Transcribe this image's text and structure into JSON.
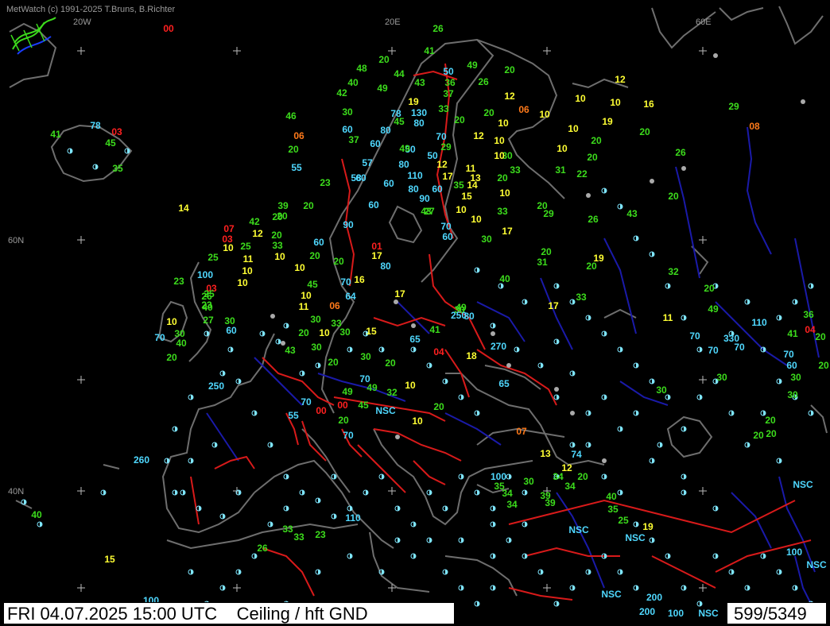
{
  "header": {
    "credit": "MetWatch  (c) 1991-2025 T.Bruns, B.Richter"
  },
  "footer": {
    "timestamp": "FRI 04.07.2025 15:00 UTC",
    "product": "Ceiling / hft GND",
    "count": "599/5349"
  },
  "colors": {
    "background": "#000000",
    "coast": "#6e6e6e",
    "river": "#1a1aa8",
    "border": "#d81a1a",
    "station": "#7fe6ff",
    "cyan_value": "#4fd8ff",
    "green_value": "#3cdc1c",
    "yellow_value": "#ffff33",
    "orange_value": "#ff7a1a",
    "red_value": "#ff2020"
  },
  "grid_labels": [
    "20W",
    "20E",
    "60E",
    "60N",
    "40N"
  ],
  "ceiling_values": [
    {
      "t": "00",
      "c": "red"
    },
    {
      "t": "26",
      "c": "green"
    },
    {
      "t": "41",
      "c": "green"
    },
    {
      "t": "50",
      "c": "cyan"
    },
    {
      "t": "49",
      "c": "green"
    },
    {
      "t": "20",
      "c": "green"
    },
    {
      "t": "48",
      "c": "green"
    },
    {
      "t": "20",
      "c": "green"
    },
    {
      "t": "44",
      "c": "green"
    },
    {
      "t": "43",
      "c": "green"
    },
    {
      "t": "36",
      "c": "green"
    },
    {
      "t": "26",
      "c": "green"
    },
    {
      "t": "40",
      "c": "green"
    },
    {
      "t": "49",
      "c": "green"
    },
    {
      "t": "37",
      "c": "green"
    },
    {
      "t": "12",
      "c": "yellow"
    },
    {
      "t": "42",
      "c": "green"
    },
    {
      "t": "19",
      "c": "yellow"
    },
    {
      "t": "10",
      "c": "yellow"
    },
    {
      "t": "10",
      "c": "yellow"
    },
    {
      "t": "16",
      "c": "yellow"
    },
    {
      "t": "12",
      "c": "yellow"
    },
    {
      "t": "29",
      "c": "green"
    },
    {
      "t": "30",
      "c": "green"
    },
    {
      "t": "78",
      "c": "cyan"
    },
    {
      "t": "130",
      "c": "cyan"
    },
    {
      "t": "33",
      "c": "green"
    },
    {
      "t": "06",
      "c": "orange"
    },
    {
      "t": "10",
      "c": "yellow"
    },
    {
      "t": "45",
      "c": "green"
    },
    {
      "t": "80",
      "c": "cyan"
    },
    {
      "t": "20",
      "c": "green"
    },
    {
      "t": "20",
      "c": "green"
    },
    {
      "t": "10",
      "c": "yellow"
    },
    {
      "t": "19",
      "c": "yellow"
    },
    {
      "t": "46",
      "c": "green"
    },
    {
      "t": "60",
      "c": "cyan"
    },
    {
      "t": "80",
      "c": "cyan"
    },
    {
      "t": "10",
      "c": "yellow"
    },
    {
      "t": "20",
      "c": "green"
    },
    {
      "t": "08",
      "c": "orange"
    },
    {
      "t": "78",
      "c": "cyan"
    },
    {
      "t": "03",
      "c": "red"
    },
    {
      "t": "06",
      "c": "orange"
    },
    {
      "t": "37",
      "c": "green"
    },
    {
      "t": "70",
      "c": "cyan"
    },
    {
      "t": "29",
      "c": "green"
    },
    {
      "t": "12",
      "c": "yellow"
    },
    {
      "t": "10",
      "c": "yellow"
    },
    {
      "t": "45",
      "c": "green"
    },
    {
      "t": "41",
      "c": "green"
    },
    {
      "t": "20",
      "c": "green"
    },
    {
      "t": "60",
      "c": "cyan"
    },
    {
      "t": "50",
      "c": "cyan"
    },
    {
      "t": "49",
      "c": "green"
    },
    {
      "t": "50",
      "c": "cyan"
    },
    {
      "t": "10",
      "c": "yellow"
    },
    {
      "t": "20",
      "c": "green"
    },
    {
      "t": "30",
      "c": "green"
    },
    {
      "t": "26",
      "c": "green"
    },
    {
      "t": "20",
      "c": "green"
    },
    {
      "t": "57",
      "c": "cyan"
    },
    {
      "t": "80",
      "c": "cyan"
    },
    {
      "t": "12",
      "c": "yellow"
    },
    {
      "t": "11",
      "c": "yellow"
    },
    {
      "t": "10",
      "c": "yellow"
    },
    {
      "t": "31",
      "c": "green"
    },
    {
      "t": "22",
      "c": "green"
    },
    {
      "t": "33",
      "c": "green"
    },
    {
      "t": "35",
      "c": "green"
    },
    {
      "t": "55",
      "c": "cyan"
    },
    {
      "t": "60",
      "c": "cyan"
    },
    {
      "t": "110",
      "c": "cyan"
    },
    {
      "t": "17",
      "c": "yellow"
    },
    {
      "t": "13",
      "c": "yellow"
    },
    {
      "t": "20",
      "c": "green"
    },
    {
      "t": "23",
      "c": "green"
    },
    {
      "t": "58",
      "c": "cyan"
    },
    {
      "t": "60",
      "c": "cyan"
    },
    {
      "t": "80",
      "c": "cyan"
    },
    {
      "t": "60",
      "c": "cyan"
    },
    {
      "t": "35",
      "c": "green"
    },
    {
      "t": "14",
      "c": "yellow"
    },
    {
      "t": "10",
      "c": "yellow"
    },
    {
      "t": "20",
      "c": "green"
    },
    {
      "t": "14",
      "c": "yellow"
    },
    {
      "t": "39",
      "c": "green"
    },
    {
      "t": "20",
      "c": "green"
    },
    {
      "t": "60",
      "c": "cyan"
    },
    {
      "t": "90",
      "c": "cyan"
    },
    {
      "t": "43",
      "c": "green"
    },
    {
      "t": "15",
      "c": "yellow"
    },
    {
      "t": "33",
      "c": "green"
    },
    {
      "t": "20",
      "c": "green"
    },
    {
      "t": "20",
      "c": "green"
    },
    {
      "t": "29",
      "c": "green"
    },
    {
      "t": "26",
      "c": "green"
    },
    {
      "t": "42",
      "c": "green"
    },
    {
      "t": "20",
      "c": "green"
    },
    {
      "t": "27",
      "c": "green"
    },
    {
      "t": "10",
      "c": "yellow"
    },
    {
      "t": "10",
      "c": "yellow"
    },
    {
      "t": "17",
      "c": "yellow"
    },
    {
      "t": "43",
      "c": "green"
    },
    {
      "t": "07",
      "c": "red"
    },
    {
      "t": "12",
      "c": "yellow"
    },
    {
      "t": "20",
      "c": "green"
    },
    {
      "t": "90",
      "c": "cyan"
    },
    {
      "t": "70",
      "c": "cyan"
    },
    {
      "t": "03",
      "c": "red"
    },
    {
      "t": "60",
      "c": "cyan"
    },
    {
      "t": "30",
      "c": "green"
    },
    {
      "t": "01",
      "c": "red"
    },
    {
      "t": "10",
      "c": "yellow"
    },
    {
      "t": "25",
      "c": "green"
    },
    {
      "t": "33",
      "c": "green"
    },
    {
      "t": "60",
      "c": "cyan"
    },
    {
      "t": "17",
      "c": "yellow"
    },
    {
      "t": "20",
      "c": "green"
    },
    {
      "t": "20",
      "c": "green"
    },
    {
      "t": "19",
      "c": "yellow"
    },
    {
      "t": "10",
      "c": "yellow"
    },
    {
      "t": "11",
      "c": "yellow"
    },
    {
      "t": "25",
      "c": "green"
    },
    {
      "t": "80",
      "c": "cyan"
    },
    {
      "t": "20",
      "c": "green"
    },
    {
      "t": "20",
      "c": "green"
    },
    {
      "t": "10",
      "c": "yellow"
    },
    {
      "t": "31",
      "c": "green"
    },
    {
      "t": "32",
      "c": "green"
    },
    {
      "t": "23",
      "c": "green"
    },
    {
      "t": "100",
      "c": "cyan"
    },
    {
      "t": "10",
      "c": "yellow"
    },
    {
      "t": "16",
      "c": "yellow"
    },
    {
      "t": "40",
      "c": "green"
    },
    {
      "t": "03",
      "c": "red"
    },
    {
      "t": "25",
      "c": "green"
    },
    {
      "t": "10",
      "c": "yellow"
    },
    {
      "t": "45",
      "c": "green"
    },
    {
      "t": "70",
      "c": "cyan"
    },
    {
      "t": "20",
      "c": "green"
    },
    {
      "t": "26",
      "c": "green"
    },
    {
      "t": "10",
      "c": "yellow"
    },
    {
      "t": "64",
      "c": "cyan"
    },
    {
      "t": "49",
      "c": "green"
    },
    {
      "t": "33",
      "c": "green"
    },
    {
      "t": "11",
      "c": "yellow"
    },
    {
      "t": "23",
      "c": "green"
    },
    {
      "t": "17",
      "c": "yellow"
    },
    {
      "t": "40",
      "c": "green"
    },
    {
      "t": "06",
      "c": "orange"
    },
    {
      "t": "17",
      "c": "yellow"
    },
    {
      "t": "80",
      "c": "cyan"
    },
    {
      "t": "30",
      "c": "green"
    },
    {
      "t": "11",
      "c": "yellow"
    },
    {
      "t": "49",
      "c": "green"
    },
    {
      "t": "10",
      "c": "yellow"
    },
    {
      "t": "27",
      "c": "green"
    },
    {
      "t": "30",
      "c": "green"
    },
    {
      "t": "30",
      "c": "green"
    },
    {
      "t": "33",
      "c": "green"
    },
    {
      "t": "15",
      "c": "yellow"
    },
    {
      "t": "04",
      "c": "red"
    },
    {
      "t": "36",
      "c": "green"
    },
    {
      "t": "110",
      "c": "cyan"
    },
    {
      "t": "250",
      "c": "cyan"
    },
    {
      "t": "60",
      "c": "cyan"
    },
    {
      "t": "20",
      "c": "green"
    },
    {
      "t": "10",
      "c": "yellow"
    },
    {
      "t": "30",
      "c": "green"
    },
    {
      "t": "41",
      "c": "green"
    },
    {
      "t": "70",
      "c": "cyan"
    },
    {
      "t": "330",
      "c": "cyan"
    },
    {
      "t": "70",
      "c": "cyan"
    },
    {
      "t": "70",
      "c": "cyan"
    },
    {
      "t": "30",
      "c": "green"
    },
    {
      "t": "40",
      "c": "green"
    },
    {
      "t": "43",
      "c": "green"
    },
    {
      "t": "30",
      "c": "green"
    },
    {
      "t": "04",
      "c": "red"
    },
    {
      "t": "18",
      "c": "yellow"
    },
    {
      "t": "41",
      "c": "green"
    },
    {
      "t": "20",
      "c": "green"
    },
    {
      "t": "270",
      "c": "cyan"
    },
    {
      "t": "30",
      "c": "green"
    },
    {
      "t": "65",
      "c": "cyan"
    },
    {
      "t": "20",
      "c": "green"
    },
    {
      "t": "20",
      "c": "green"
    },
    {
      "t": "20",
      "c": "green"
    },
    {
      "t": "70",
      "c": "cyan"
    },
    {
      "t": "70",
      "c": "cyan"
    },
    {
      "t": "70",
      "c": "cyan"
    },
    {
      "t": "65",
      "c": "cyan"
    },
    {
      "t": "60",
      "c": "cyan"
    },
    {
      "t": "30",
      "c": "green"
    },
    {
      "t": "20",
      "c": "green"
    },
    {
      "t": "250",
      "c": "cyan"
    },
    {
      "t": "49",
      "c": "green"
    },
    {
      "t": "10",
      "c": "yellow"
    },
    {
      "t": "30",
      "c": "green"
    },
    {
      "t": "49",
      "c": "green"
    },
    {
      "t": "32",
      "c": "green"
    },
    {
      "t": "30",
      "c": "green"
    },
    {
      "t": "70",
      "c": "cyan"
    },
    {
      "t": "00",
      "c": "red"
    },
    {
      "t": "45",
      "c": "green"
    },
    {
      "t": "NSC",
      "c": "cyan"
    },
    {
      "t": "20",
      "c": "green"
    },
    {
      "t": "55",
      "c": "cyan"
    },
    {
      "t": "00",
      "c": "red"
    },
    {
      "t": "20",
      "c": "green"
    },
    {
      "t": "10",
      "c": "yellow"
    },
    {
      "t": "20",
      "c": "green"
    },
    {
      "t": "70",
      "c": "cyan"
    },
    {
      "t": "07",
      "c": "orange"
    },
    {
      "t": "13",
      "c": "yellow"
    },
    {
      "t": "74",
      "c": "cyan"
    },
    {
      "t": "260",
      "c": "cyan"
    },
    {
      "t": "12",
      "c": "yellow"
    },
    {
      "t": "100",
      "c": "cyan"
    },
    {
      "t": "30",
      "c": "green"
    },
    {
      "t": "34",
      "c": "green"
    },
    {
      "t": "20",
      "c": "green"
    },
    {
      "t": "35",
      "c": "green"
    },
    {
      "t": "34",
      "c": "green"
    },
    {
      "t": "NSC",
      "c": "cyan"
    },
    {
      "t": "34",
      "c": "green"
    },
    {
      "t": "39",
      "c": "green"
    },
    {
      "t": "40",
      "c": "green"
    },
    {
      "t": "34",
      "c": "green"
    },
    {
      "t": "39",
      "c": "green"
    },
    {
      "t": "35",
      "c": "green"
    },
    {
      "t": "40",
      "c": "green"
    },
    {
      "t": "110",
      "c": "cyan"
    },
    {
      "t": "25",
      "c": "green"
    },
    {
      "t": "NSC",
      "c": "cyan"
    },
    {
      "t": "19",
      "c": "yellow"
    },
    {
      "t": "33",
      "c": "green"
    },
    {
      "t": "33",
      "c": "green"
    },
    {
      "t": "23",
      "c": "green"
    },
    {
      "t": "NSC",
      "c": "cyan"
    },
    {
      "t": "26",
      "c": "green"
    },
    {
      "t": "100",
      "c": "cyan"
    },
    {
      "t": "15",
      "c": "yellow"
    },
    {
      "t": "NSC",
      "c": "cyan"
    },
    {
      "t": "NSC",
      "c": "cyan"
    },
    {
      "t": "200",
      "c": "cyan"
    },
    {
      "t": "100",
      "c": "cyan"
    },
    {
      "t": "NSC",
      "c": "cyan"
    },
    {
      "t": "200",
      "c": "cyan"
    },
    {
      "t": "100",
      "c": "cyan"
    },
    {
      "t": "30",
      "c": "green"
    },
    {
      "t": "20",
      "c": "green"
    },
    {
      "t": "20",
      "c": "green"
    }
  ]
}
